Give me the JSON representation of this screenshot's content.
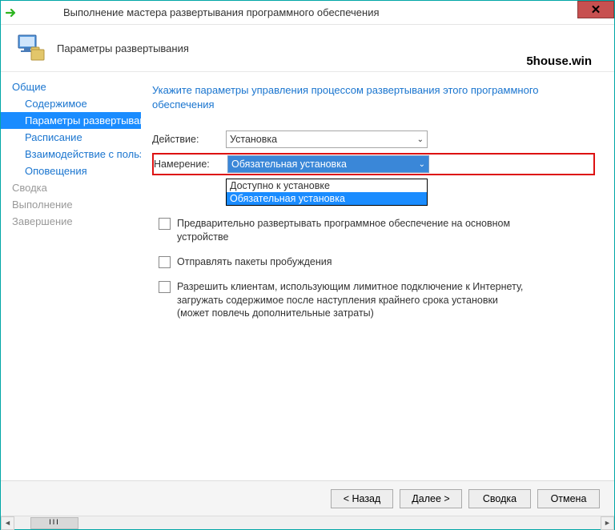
{
  "titlebar": {
    "title": "Выполнение мастера развертывания программного обеспечения"
  },
  "header": {
    "subtitle": "Параметры развертывания",
    "watermark": "5house.win"
  },
  "sidebar": {
    "items": [
      {
        "label": "Общие",
        "sub": false
      },
      {
        "label": "Содержимое",
        "sub": true
      },
      {
        "label": "Параметры развертывания",
        "sub": true,
        "selected": true
      },
      {
        "label": "Расписание",
        "sub": true
      },
      {
        "label": "Взаимодействие с пользователем",
        "sub": true
      },
      {
        "label": "Оповещения",
        "sub": true
      },
      {
        "label": "Сводка",
        "sub": false,
        "disabled": true
      },
      {
        "label": "Выполнение",
        "sub": false,
        "disabled": true
      },
      {
        "label": "Завершение",
        "sub": false,
        "disabled": true
      }
    ]
  },
  "main": {
    "instruction": "Укажите параметры управления процессом развертывания этого программного обеспечения",
    "action_label": "Действие:",
    "action_value": "Установка",
    "intent_label": "Намерение:",
    "intent_value": "Обязательная установка",
    "intent_options": [
      "Доступно к установке",
      "Обязательная установка"
    ],
    "check1": "Предварительно развертывать программное обеспечение на основном устройстве",
    "check2": "Отправлять пакеты пробуждения",
    "check3": "Разрешить клиентам, использующим лимитное подключение к Интернету, загружать содержимое после наступления крайнего срока установки (может повлечь дополнительные затраты)"
  },
  "footer": {
    "back": "< Назад",
    "next": "Далее >",
    "summary": "Сводка",
    "cancel": "Отмена"
  },
  "scrollbar": {
    "thumb": "III"
  }
}
